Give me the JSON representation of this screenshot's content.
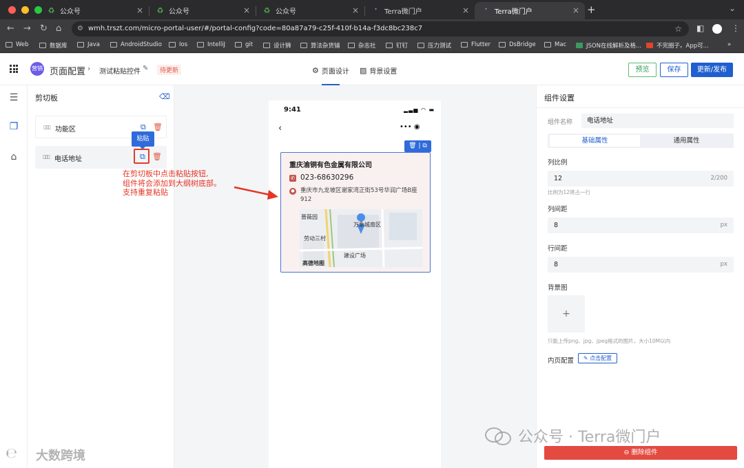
{
  "browser": {
    "tabs": [
      {
        "title": "公众号",
        "active": false
      },
      {
        "title": "公众号",
        "active": false
      },
      {
        "title": "公众号",
        "active": false
      },
      {
        "title": "Terra微门户",
        "active": false
      },
      {
        "title": "Terra微门户",
        "active": true
      }
    ],
    "url": "wmh.trszt.com/micro-portal-user/#/portal-config?code=80a87a79-c25f-410f-b14a-f3dc8bc238c7",
    "bookmarks": [
      "Web",
      "数据库",
      "Java",
      "AndroidStudio",
      "Ios",
      "IntelliJ",
      "git",
      "设计狮",
      "算法杂货铺",
      "杂志社",
      "钉钉",
      "压力测试",
      "Flutter",
      "DsBridge",
      "Mac",
      "JSON在线解析及格...",
      "不完圈子。App可..."
    ],
    "more": "»"
  },
  "header": {
    "logo_text": "营销",
    "title": "页面配置",
    "page_name": "测试粘贴控件",
    "status_badge": "待更新",
    "tabs": [
      "页面设计",
      "背景设置"
    ],
    "preview_label": "预览",
    "save_label": "保存",
    "publish_label": "更新/发布"
  },
  "clipboard": {
    "title": "剪切板",
    "items": [
      "功能区",
      "电话地址"
    ],
    "paste_tooltip": "粘贴",
    "annotation": "在剪切板中点击粘贴按钮,\n组件将会添加到大纲树底部。\n支持重复粘贴"
  },
  "phone": {
    "time": "9:41",
    "company": "重庆渝铜有色金属有限公司",
    "phone": "023-68630296",
    "address": "重庆市九龙坡区谢家湾正街53号华润广场B座912",
    "map_labels": [
      "蔷薇园",
      "万象城南区",
      "劳动三村",
      "建设广场",
      "高德地图"
    ]
  },
  "settings": {
    "title": "组件设置",
    "name_label": "组件名称",
    "name_value": "电话地址",
    "tab_basic": "基础属性",
    "tab_general": "通用属性",
    "col_ratio_label": "列比例",
    "col_ratio_value": "12",
    "col_ratio_count": "2/200",
    "col_ratio_hint": "比例为12将占一行",
    "col_gap_label": "列间距",
    "col_gap_value": "8",
    "row_gap_label": "行间距",
    "row_gap_value": "8",
    "unit": "px",
    "bg_label": "背景图",
    "upload_plus": "+",
    "upload_hint": "只能上传png、jpg、jpeg格式的图片，大小10M以内",
    "inner_label": "内页配置",
    "inner_btn": "点击配置",
    "delete_label": "删除组件"
  },
  "watermark": {
    "right": "公众号 · Terra微门户",
    "left": "大数跨境"
  },
  "colors": {
    "primary": "#1f5fcf",
    "danger": "#e34a40",
    "success": "#2f9e54",
    "annotation": "#e53424"
  }
}
